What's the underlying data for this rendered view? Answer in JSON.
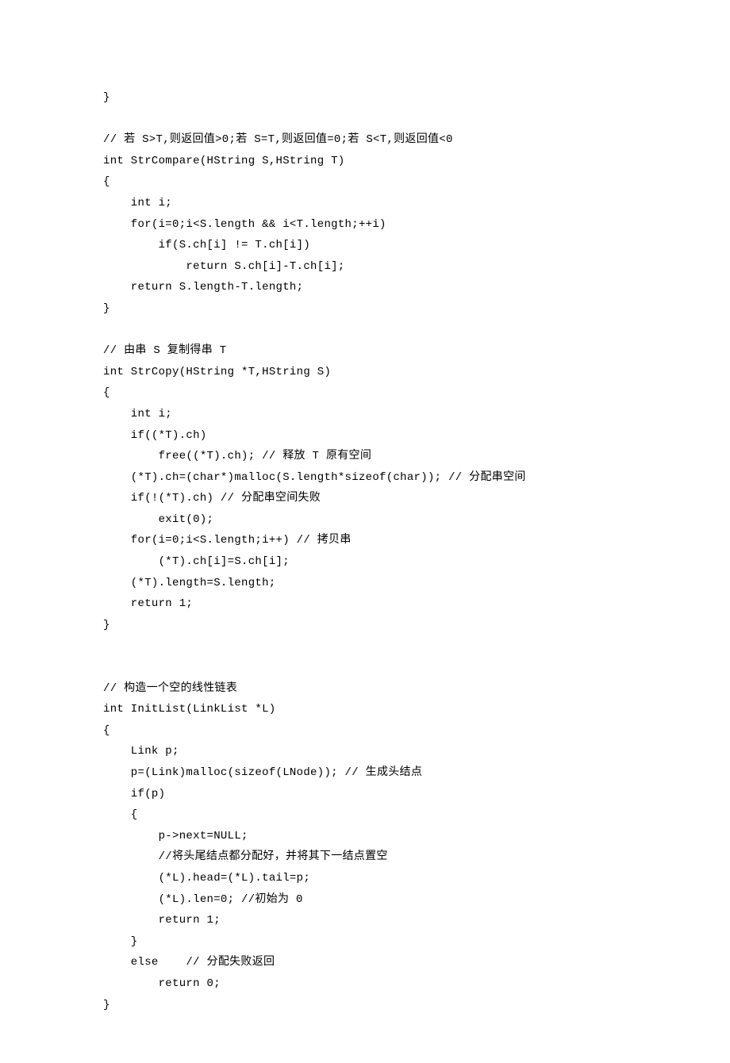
{
  "code": {
    "lines": [
      "}",
      "",
      "// 若 S>T,则返回值>0;若 S=T,则返回值=0;若 S<T,则返回值<0",
      "int StrCompare(HString S,HString T)",
      "{",
      "    int i;",
      "    for(i=0;i<S.length && i<T.length;++i)",
      "        if(S.ch[i] != T.ch[i])",
      "            return S.ch[i]-T.ch[i];",
      "    return S.length-T.length;",
      "}",
      "",
      "// 由串 S 复制得串 T",
      "int StrCopy(HString *T,HString S)",
      "{",
      "    int i;",
      "    if((*T).ch)",
      "        free((*T).ch); // 释放 T 原有空间",
      "    (*T).ch=(char*)malloc(S.length*sizeof(char)); // 分配串空间",
      "    if(!(*T).ch) // 分配串空间失败",
      "        exit(0);",
      "    for(i=0;i<S.length;i++) // 拷贝串",
      "        (*T).ch[i]=S.ch[i];",
      "    (*T).length=S.length;",
      "    return 1;",
      "}",
      "",
      "",
      "// 构造一个空的线性链表",
      "int InitList(LinkList *L)",
      "{",
      "    Link p;",
      "    p=(Link)malloc(sizeof(LNode)); // 生成头结点",
      "    if(p)",
      "    {",
      "        p->next=NULL;",
      "        //将头尾结点都分配好，并将其下一结点置空",
      "        (*L).head=(*L).tail=p;",
      "        (*L).len=0; //初始为 0",
      "        return 1;",
      "    }",
      "    else    // 分配失败返回",
      "        return 0;",
      "}"
    ]
  }
}
